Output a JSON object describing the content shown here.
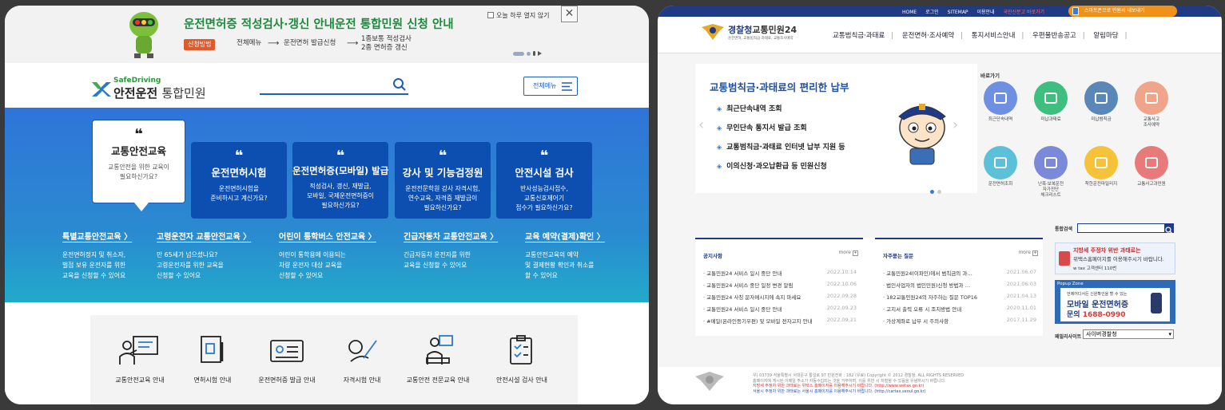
{
  "left": {
    "banner": {
      "title": "운전면허증 적성검사·갱신 안내운전 통합민원 신청 안내",
      "method": "신청방법",
      "step1": "전체메뉴",
      "step2": "운전면허 발급신청",
      "step3a": "1종보통 적성검사",
      "step3b": "2종 면허증 갱신",
      "arrow": "⟶",
      "not_today": "오늘 하루 열지 않기",
      "close": "✕"
    },
    "header": {
      "logo_sd": "SafeDriving",
      "logo_main": "안전운전",
      "logo_sub": "통합민원",
      "menu_label": "전체메뉴"
    },
    "cards": [
      {
        "q": "❝",
        "title": "교통안전교육",
        "desc": "교통안전을 위한 교육이\n필요하신가요?"
      },
      {
        "q": "❝",
        "title": "운전면허시험",
        "desc": "운전면허시험을\n준비하시고 계신가요?"
      },
      {
        "q": "❝",
        "title": "운전면허증(모바일) 발급",
        "desc": "적성검사, 갱신, 재발급,\n모바일, 국제운전면허증이\n필요하신가요?"
      },
      {
        "q": "❝",
        "title": "강사 및 기능검정원",
        "desc": "운전전문학원 강사 자격시험,\n연수교육, 자격증 재발급이\n필요하신가요?"
      },
      {
        "q": "❝",
        "title": "안전시설 검사",
        "desc": "반사성능검사접수,\n교통신호제어기\n접수가 필요하신가요?"
      }
    ],
    "links": [
      {
        "title": "특별교통안전교육 〉",
        "desc": "운전면허정지 및 취소자,\n벌점 보유 운전자를 위한\n교육을 신청할 수 있어요"
      },
      {
        "title": "고령운전자 교통안전교육 〉",
        "desc": "만 65세가 넘으셨나요?\n고령운전자를 위한 교육을\n신청할 수 있어요"
      },
      {
        "title": "어린이 통학버스 안전교육 〉",
        "desc": "어린이 통학용에 이용되는\n차량 운전자 대상 교육을\n신청할 수 있어요"
      },
      {
        "title": "긴급자동차 교통안전교육 〉",
        "desc": "긴급자동차 운전자를 위한\n교육을 신청할 수 있어요"
      },
      {
        "title": "교육 예약(결제)확인 〉",
        "desc": "교통안전교육의 예약\n및 결제현황 확인과 취소를\n할 수 있어요"
      }
    ],
    "services": [
      "교통안전교육 안내",
      "면허시험 안내",
      "운전면허증 발급 안내",
      "자격시험 안내",
      "교통안전 전문교육 안내",
      "안전시설 검사 안내"
    ]
  },
  "right": {
    "topbar": {
      "links": [
        "HOME",
        "로그인",
        "SITEMAP",
        "이용안내"
      ],
      "red": "국민신문고 바로가기",
      "btn": "스마트폰으로 민원서 내보내기"
    },
    "logo": {
      "main_a": "경찰청",
      "main_b": "교통민원24",
      "sub": "운전면허, 교통범칙금·과태료, 교통조사예약"
    },
    "menu": [
      "교통범칙금·과태료",
      "운전면허·조사예약",
      "통지서비스안내",
      "우편물반송공고",
      "알림마당"
    ],
    "slider": {
      "title": "교통범칙금·과태료의 편리한 납부",
      "items": [
        "최근단속내역 조회",
        "무인단속 통지서 발급 조회",
        "교통범칙금·과태료 인터넷 납부 지원 등",
        "이의신청·과오납환급 등 민원신청"
      ],
      "bullet": "◈",
      "prev": "‹",
      "next": "›"
    },
    "quick_title": "바로가기",
    "quick": [
      {
        "label": "최근단속내역",
        "color": "#6f8fe0"
      },
      {
        "label": "미납과태료",
        "color": "#3fbf7f"
      },
      {
        "label": "미납범칙금",
        "color": "#5a86b8"
      },
      {
        "label": "교통사고\n조사예약",
        "color": "#f0a48a"
      },
      {
        "label": "운전면허조회",
        "color": "#5cc0d8"
      },
      {
        "label": "난폭·보복운전\n자가진단\n체크리스트",
        "color": "#7a8ad8"
      },
      {
        "label": "착한운전마일리지",
        "color": "#f5c23a"
      },
      {
        "label": "교통사고과민원",
        "color": "#e87a7a"
      }
    ],
    "notice": {
      "title": "공지사항",
      "more": "more",
      "rows": [
        {
          "t": "· 교통민원24 서비스 일시 중단 안내",
          "d": "2022.10.14"
        },
        {
          "t": "· 교통민원24 서비스 중단 일정 변경 알림",
          "d": "2022.10.06"
        },
        {
          "t": "· 교통민원24 사칭 문자메시지에 속지 마세요",
          "d": "2022.09.28"
        },
        {
          "t": "· 교통민원24 서비스 일시 중단 안내",
          "d": "2022.09.23"
        },
        {
          "t": "· #메일(온라인등기우편) 및 모바일 전자고지 안내",
          "d": "2022.09.21"
        }
      ]
    },
    "faq": {
      "title": "자주묻는 질문",
      "more": "more",
      "rows": [
        {
          "t": "· 교통민원24(이파인)에서 범칙금의 과…",
          "d": "2021.06.07"
        },
        {
          "t": "· 법인사업자의 법인민원)신청 방법과 …",
          "d": "2021.06.03"
        },
        {
          "t": "· 182교통민원24의 자주하는 질문 TOP16",
          "d": "2021.04.13"
        },
        {
          "t": "· 고지서 출력 오류 시 조치방법 안내",
          "d": "2020.11.01"
        },
        {
          "t": "· 가상계좌로 납부 시 주의사항",
          "d": "2017.11.29"
        }
      ]
    },
    "search_label": "통합검색",
    "ad1": {
      "a": "지방세 주정차 위반 과태료는",
      "b": "위택스홈페이지를 이용해주시기 바랍니다.",
      "c": "w tax 고객센터 110번"
    },
    "ad2": {
      "t": "Popup Zone",
      "w1": "언제어디서든 신원확인을 할 수 있는",
      "w2": "모바일 운전면허증",
      "w3a": "문의 ",
      "w3b": "1688-0990"
    },
    "family_label": "패밀리사이트",
    "family_value": "사이버경찰청",
    "footer": {
      "l1": "우) 03739 서울특별시 서대문구 통일로 97  민원전화 : 182 (유료)      Copyright © 2012 경찰청. ALL RIGHTS RESERVED",
      "l2": "홈페이지에 게시된 이메일 주소가 자동수집되는 것을 거부하며, 이를 위반 시 처벌될 수 있음을 유념하시기 바랍니다.",
      "l3": "지방세 주정차 위반 과태료는 위택스 홈페이지를 이용해주시기 바랍니다. (http://www.wetax.go.kr)",
      "l4": "서울시 주정차 위반 과태료는 서울시 홈페이지를 이용해주시기 바랍니다. (http://cartax.seoul.go.kr)"
    }
  }
}
